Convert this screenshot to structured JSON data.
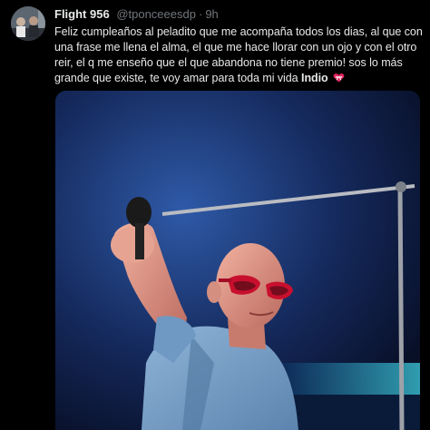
{
  "tweet": {
    "display_name": "Flight 956",
    "handle": "@tponceeesdp",
    "separator": "·",
    "time": "9h",
    "text_main": "Feliz cumpleaños al peladito que me acompaña todos los dias, al que con una frase me llena el alma, el que me hace llorar con un ojo y con el otro reir, el q me enseño que el que abandona no tiene premio! sos lo más grande que existe, te voy amar para toda mi vida",
    "text_bold": "Indio",
    "emoji_icon": "heart-with-ribbon-icon"
  },
  "colors": {
    "background": "#000000",
    "primary_text": "#e7e9ea",
    "secondary_text": "#71767b"
  }
}
